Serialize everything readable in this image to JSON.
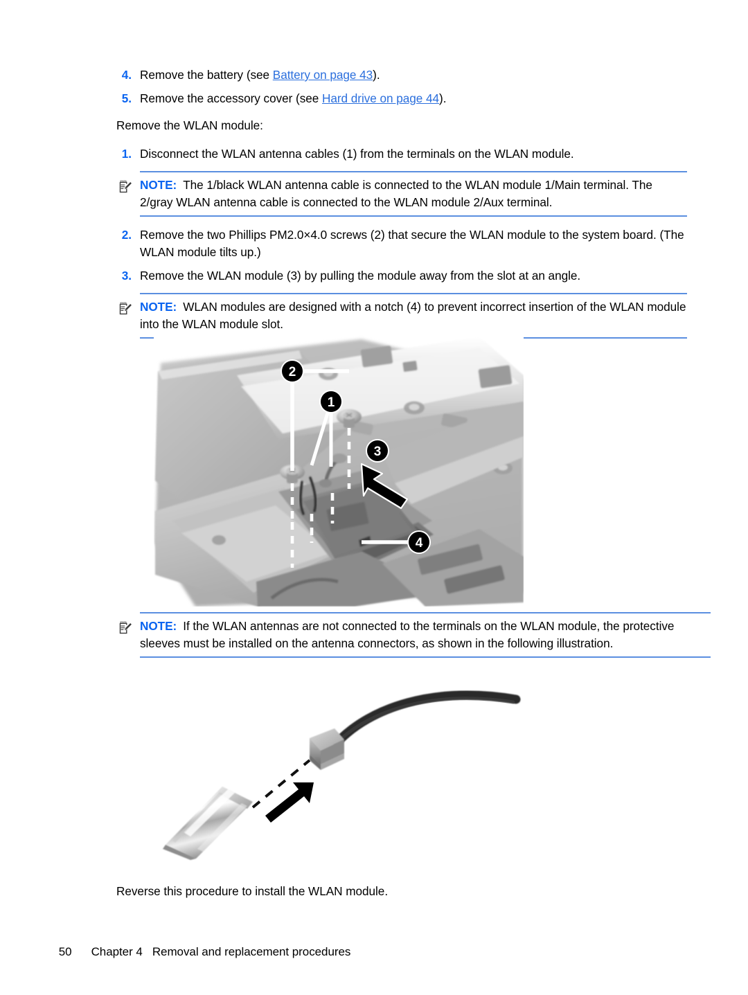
{
  "document": {
    "type": "service-manual-page",
    "accent_blue": "#0a64f0",
    "link_blue": "#2b6fdd",
    "rule_blue": "#5b8fe0"
  },
  "prelim_steps": [
    {
      "num": "4.",
      "pre": "Remove the battery (see ",
      "link": "Battery on page 43",
      "post": ")."
    },
    {
      "num": "5.",
      "pre": "Remove the accessory cover (see ",
      "link": "Hard drive on page 44",
      "post": ")."
    }
  ],
  "lead_in": "Remove the WLAN module:",
  "steps": [
    {
      "num": "1.",
      "parts": [
        {
          "t": "Disconnect the WLAN antenna cables ",
          "b": false
        },
        {
          "t": "(1)",
          "b": true
        },
        {
          "t": " from the terminals on the WLAN module.",
          "b": false
        }
      ]
    },
    {
      "num": "2.",
      "parts": [
        {
          "t": "Remove the two Phillips PM2.0×4.0 screws ",
          "b": false
        },
        {
          "t": "(2)",
          "b": true
        },
        {
          "t": " that secure the WLAN module to the system board. (The WLAN module tilts up.)",
          "b": false
        }
      ]
    },
    {
      "num": "3.",
      "parts": [
        {
          "t": "Remove the WLAN module ",
          "b": false
        },
        {
          "t": "(3)",
          "b": true
        },
        {
          "t": " by pulling the module away from the slot at an angle.",
          "b": false
        }
      ]
    }
  ],
  "notes": [
    {
      "id": "note-antenna-terminals",
      "label": "NOTE:",
      "icon": "notepad-pencil-icon",
      "parts": [
        {
          "t": "The 1/black WLAN antenna cable is connected to the WLAN module 1/Main terminal. The 2/gray WLAN antenna cable is connected to the WLAN module 2/Aux terminal.",
          "b": false
        }
      ]
    },
    {
      "id": "note-module-notch",
      "label": "NOTE:",
      "icon": "notepad-pencil-icon",
      "parts": [
        {
          "t": "WLAN modules are designed with a notch ",
          "b": false
        },
        {
          "t": "(4)",
          "b": true
        },
        {
          "t": " to prevent incorrect insertion of the WLAN module into the WLAN module slot.",
          "b": false
        }
      ]
    },
    {
      "id": "note-protective-sleeves",
      "label": "NOTE:",
      "icon": "notepad-pencil-icon",
      "parts": [
        {
          "t": "If the WLAN antennas are not connected to the terminals on the WLAN module, the protective sleeves must be installed on the antenna connectors, as shown in the following illustration.",
          "b": false
        }
      ]
    }
  ],
  "figure_wlan_module": {
    "name": "wlan-module-removal-photo",
    "description": "Grayscale photo of laptop underside showing WLAN module bay",
    "callouts": [
      {
        "label": "2",
        "meaning": "Phillips PM2.0x4.0 screws"
      },
      {
        "label": "1",
        "meaning": "WLAN antenna cables"
      },
      {
        "label": "3",
        "meaning": "WLAN module pull direction"
      },
      {
        "label": "4",
        "meaning": "WLAN module notch"
      }
    ]
  },
  "figure_antenna_sleeve": {
    "name": "antenna-protective-sleeve-illustration",
    "description": "Antenna cable connector with protective sleeve being installed"
  },
  "closing_text": "Reverse this procedure to install the WLAN module.",
  "footer": {
    "page_number": "50",
    "chapter": "Chapter 4",
    "chapter_title": "Removal and replacement procedures"
  }
}
